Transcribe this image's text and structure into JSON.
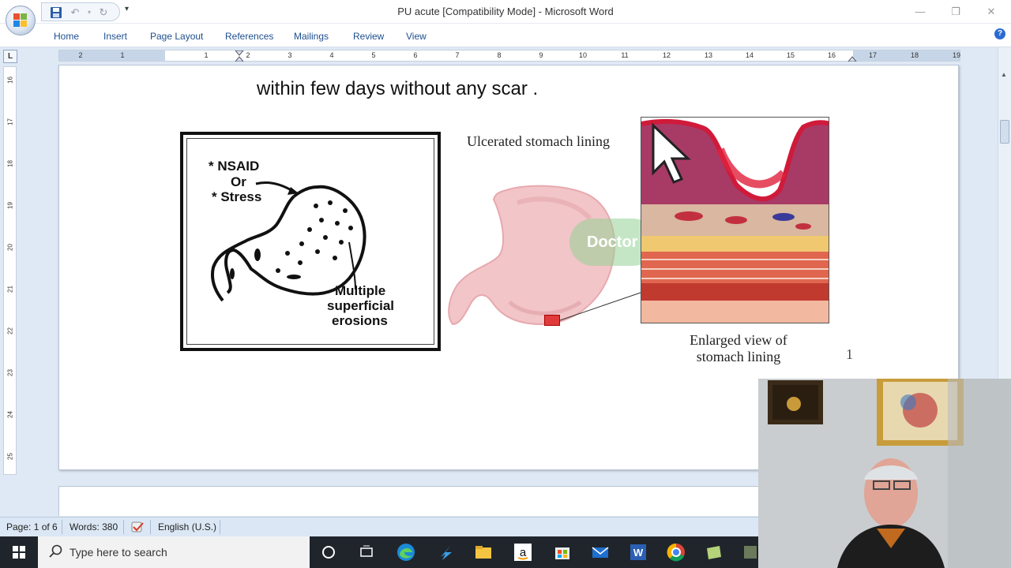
{
  "window": {
    "title": "PU acute  [Compatibility Mode] - Microsoft Word",
    "controls": {
      "minimize": "—",
      "restore": "❐",
      "close": "✕"
    }
  },
  "qat": {
    "more": "▾"
  },
  "ribbon": {
    "tabs": [
      "Home",
      "Insert",
      "Page Layout",
      "References",
      "Mailings",
      "Review",
      "View"
    ],
    "help": "?"
  },
  "ruler": {
    "tab_selector": "L",
    "h_numbers": [
      "2",
      "1",
      "1",
      "2",
      "3",
      "4",
      "5",
      "6",
      "7",
      "8",
      "9",
      "10",
      "11",
      "12",
      "13",
      "14",
      "15",
      "16",
      "17",
      "18",
      "19"
    ],
    "v_numbers": [
      "16",
      "17",
      "18",
      "19",
      "20",
      "21",
      "22",
      "23",
      "24",
      "25"
    ]
  },
  "document": {
    "line": "within few days without any scar .",
    "diagram": {
      "cause_1": "* NSAID",
      "cause_or": "Or",
      "cause_2": "* Stress",
      "erosions_1": "Multiple",
      "erosions_2": "superficial",
      "erosions_3": "erosions"
    },
    "ulcer_label": "Ulcerated stomach lining",
    "watermark": "Doctor",
    "enlarged_label_1": "Enlarged view of",
    "enlarged_label_2": "stomach lining",
    "figure_number": "1"
  },
  "statusbar": {
    "page": "Page: 1 of 6",
    "words": "Words: 380",
    "language": "English (U.S.)"
  },
  "taskbar": {
    "search_placeholder": "Type here to search"
  },
  "colors": {
    "accent": "#1e4f8f",
    "taskbar": "#20252c",
    "statusbar": "#dbe7f5"
  }
}
